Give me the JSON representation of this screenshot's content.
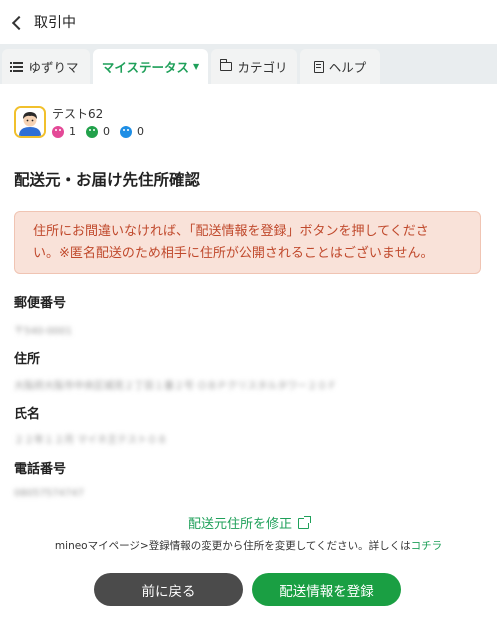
{
  "header": {
    "back_label": "取引中"
  },
  "tabs": [
    {
      "label": "ゆずりマ"
    },
    {
      "label": "マイステータス"
    },
    {
      "label": "カテゴリ"
    },
    {
      "label": "ヘルプ"
    }
  ],
  "user": {
    "name": "テスト62",
    "ratings": [
      {
        "type": "good",
        "count": "1"
      },
      {
        "type": "normal",
        "count": "0"
      },
      {
        "type": "bad",
        "count": "0"
      }
    ]
  },
  "page_title": "配送元・お届け先住所確認",
  "notice": {
    "line1": "住所にお間違いなければ、「配送情報を登録」ボタンを押してくださ",
    "line2": "い。※匿名配送のため相手に住所が公開されることはございません。"
  },
  "fields": {
    "postal_label": "郵便番号",
    "postal_value": "〒540-0001",
    "address_label": "住所",
    "address_value": "大阪府大阪市中央区城見２丁目１番２号 ＯＢＰクリスタルタワー２０Ｆ",
    "name_label": "氏名",
    "name_value": "２２年１２月 マイネ王テスト０８",
    "phone_label": "電話番号",
    "phone_value": "08057574747"
  },
  "fix_link": "配送元住所を修正",
  "help": {
    "text": "mineoマイページ>登録情報の変更から住所を変更してください。詳しくは",
    "link": "コチラ"
  },
  "buttons": {
    "back": "前に戻る",
    "register": "配送情報を登録"
  },
  "colors": {
    "accent_green": "#1a9f43",
    "notice_bg": "#f9e2d9",
    "notice_text": "#c0492c",
    "avatar_border": "#f1c02c"
  }
}
